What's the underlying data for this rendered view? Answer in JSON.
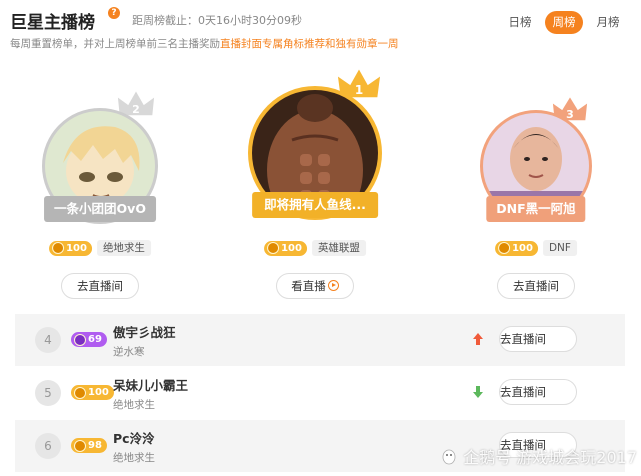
{
  "header": {
    "title": "巨星主播榜",
    "help_badge": "?",
    "countdown": "距周榜截止：0天16小时30分09秒",
    "subtitle_prefix": "每周重置榜单，并对上周榜单前三名主播奖励",
    "subtitle_highlight": "直播封面专属角标推荐和独有勋章一周"
  },
  "tabs": [
    {
      "label": "日榜",
      "active": false
    },
    {
      "label": "周榜",
      "active": true
    },
    {
      "label": "月榜",
      "active": false
    }
  ],
  "podium": [
    {
      "rank": "2",
      "name": "一条小团团OvO",
      "level": "100",
      "game": "绝地求生",
      "button": "去直播间",
      "crown_color": "#d8d8d8",
      "ribbon_color": "#b5b5b5"
    },
    {
      "rank": "1",
      "name": "即将拥有人鱼线...",
      "level": "100",
      "game": "英雄联盟",
      "button": "看直播",
      "crown_color": "#f7b733",
      "ribbon_color": "#f2b128"
    },
    {
      "rank": "3",
      "name": "DNF黑一阿旭",
      "level": "100",
      "game": "DNF",
      "button": "去直播间",
      "crown_color": "#f2a27c",
      "ribbon_color": "#f0a07a"
    }
  ],
  "list": [
    {
      "rank": "4",
      "level": "69",
      "name": "傲宇彡战狂",
      "game": "逆水寒",
      "trend": "up",
      "button": "去直播间",
      "badge_style": "purple"
    },
    {
      "rank": "5",
      "level": "100",
      "name": "呆妹儿小霸王",
      "game": "绝地求生",
      "trend": "down",
      "button": "去直播间",
      "badge_style": "gold"
    },
    {
      "rank": "6",
      "level": "98",
      "name": "Pc泠泠",
      "game": "绝地求生",
      "trend": "",
      "button": "去直播间",
      "badge_style": "gold"
    }
  ],
  "watermark": "企鹅号 游戏城会玩2017",
  "colors": {
    "accent": "#f5821f",
    "up": "#f05a3a",
    "down": "#5cb85c"
  }
}
